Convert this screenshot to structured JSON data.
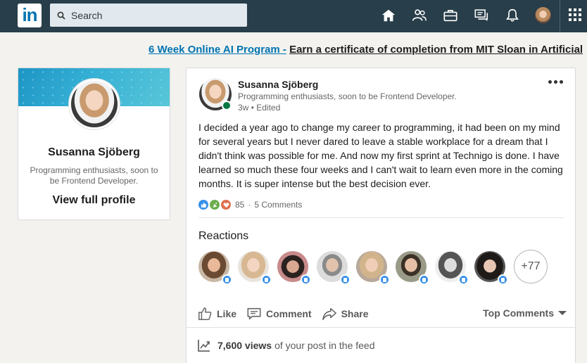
{
  "nav": {
    "logo_text": "in",
    "search_placeholder": "Search",
    "icons": [
      "home-icon",
      "my-network-icon",
      "jobs-icon",
      "messaging-icon",
      "notifications-icon",
      "me-avatar",
      "work-grid-icon"
    ]
  },
  "ad": {
    "link_text": "6 Week Online AI Program -",
    "tagline": "Earn a certificate of completion from MIT Sloan in Artificial"
  },
  "profile": {
    "name": "Susanna Sjöberg",
    "headline": "Programming enthusiasts, soon to be Frontend Developer.",
    "view_profile_label": "View full profile"
  },
  "post": {
    "author_name": "Susanna Sjöberg",
    "author_headline": "Programming enthusiasts, soon to be Frontend Developer.",
    "time": "3w",
    "edited_label": "Edited",
    "text": "I decided a year ago to change my career to programming, it had been on my mind for several years but I never dared to leave a stable workplace for a dream that I didn't think was possible for me. And now my first sprint at Technigo is done. I have learned so much these four weeks and I can't wait to learn even more in the coming months. It is super intense but the best decision ever.",
    "reaction_count": "85",
    "comments_label": "5 Comments",
    "reactions_title": "Reactions",
    "more_reactors": "+77",
    "actions": {
      "like": "Like",
      "comment": "Comment",
      "share": "Share",
      "sort": "Top Comments"
    },
    "views_count": "7,600 views",
    "views_suffix": "of your post in the feed"
  },
  "colors": {
    "nav_bg": "#283e4a",
    "brand_blue": "#0073b1",
    "online_green": "#057642",
    "like_blue": "#378fe9"
  }
}
